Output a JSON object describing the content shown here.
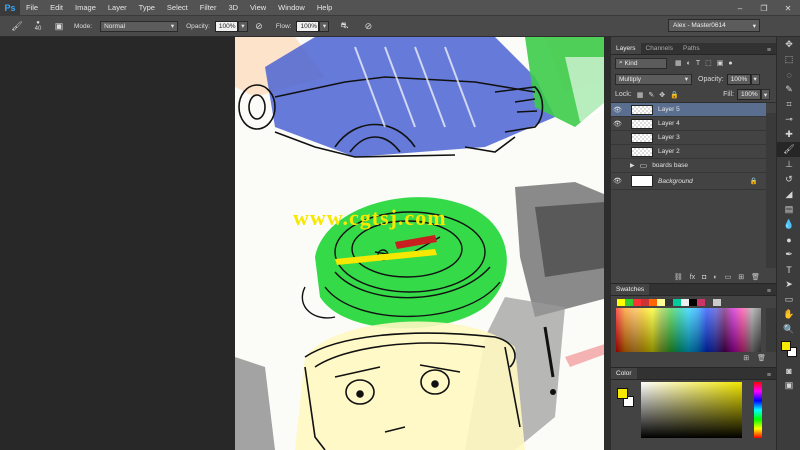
{
  "app": {
    "logo": "Ps",
    "workspace": "Alex - Master0614"
  },
  "menu": [
    "File",
    "Edit",
    "Image",
    "Layer",
    "Type",
    "Select",
    "Filter",
    "3D",
    "View",
    "Window",
    "Help"
  ],
  "options": {
    "brush_size": "40",
    "mode_label": "Mode:",
    "mode_value": "Normal",
    "opacity_label": "Opacity:",
    "opacity_value": "100%",
    "flow_label": "Flow:",
    "flow_value": "100%"
  },
  "watermark": "www.cgtsj.com",
  "layers_panel": {
    "tabs": [
      "Layers",
      "Channels",
      "Paths"
    ],
    "kind": "Kind",
    "blend": "Multiply",
    "opacity_label": "Opacity:",
    "opacity_value": "100%",
    "lock_label": "Lock:",
    "fill_label": "Fill:",
    "fill_value": "100%",
    "layers": [
      {
        "name": "Layer 5",
        "visible": true,
        "selected": true
      },
      {
        "name": "Layer 4",
        "visible": true,
        "selected": false
      },
      {
        "name": "Layer 3",
        "visible": false,
        "selected": false
      },
      {
        "name": "Layer 2",
        "visible": false,
        "selected": false
      },
      {
        "name": "boards base",
        "visible": false,
        "selected": false,
        "group": true
      },
      {
        "name": "Background",
        "visible": true,
        "selected": false,
        "locked": true
      }
    ]
  },
  "swatches_panel": {
    "title": "Swatches"
  },
  "color_panel": {
    "title": "Color",
    "foreground": "#f6e800",
    "background": "#ffffff"
  },
  "colors": {
    "accent": "#31a8ff",
    "selection": "#5a6f90"
  }
}
